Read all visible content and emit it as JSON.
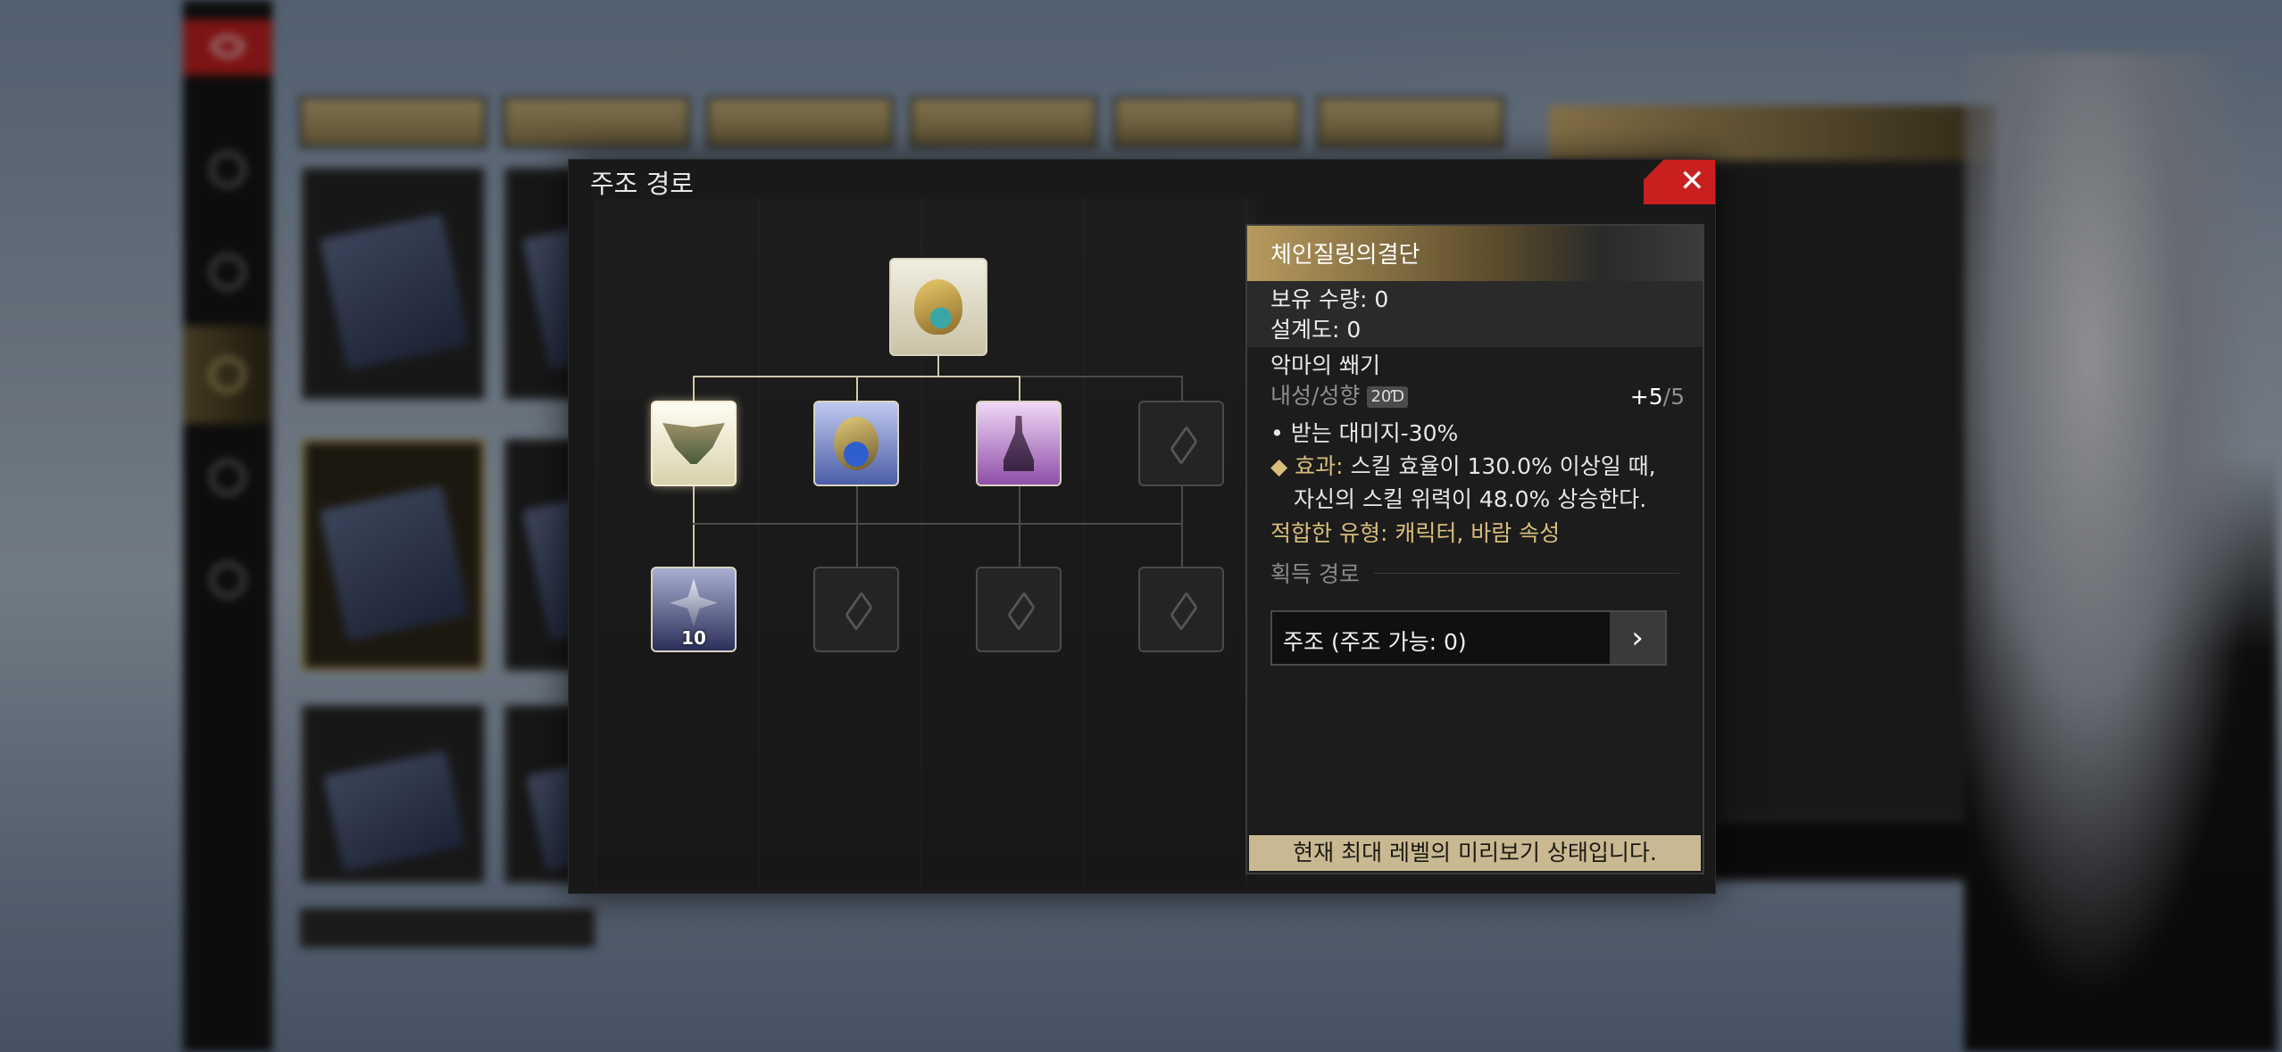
{
  "modal": {
    "title": "주조 경로",
    "close_symbol": "✕"
  },
  "tree": {
    "root_node": "chain-knight-pledge-icon",
    "level_badge": "10"
  },
  "detail": {
    "name": "체인질링의결단",
    "owned_label": "보유 수량: 0",
    "blueprint_label": "설계도: 0",
    "set_name": "악마의 쐐기",
    "resist_label": "내성/성향",
    "resist_badge": "20Ɗ",
    "affinity_value": "+5",
    "affinity_max": "/5",
    "bullet_1": "• 받는 대미지-30%",
    "effect_prefix": "◆ 효과:",
    "effect_line_1": "스킬 효율이 130.0% 이상일 때,",
    "effect_line_2": "자신의 스킬 위력이 48.0% 상승한다.",
    "suitable": "적합한 유형: 캐릭터, 바람 속성",
    "obtain_title": "획득 경로",
    "route_button": "주조 (주조 가능: 0)",
    "route_arrow": "›",
    "preview_notice": "현재 최대 레벨의 미리보기 상태입니다."
  },
  "colors": {
    "accent_red": "#c9201f",
    "gold_text": "#d8bd7b",
    "notice_bg": "#c9b992"
  }
}
